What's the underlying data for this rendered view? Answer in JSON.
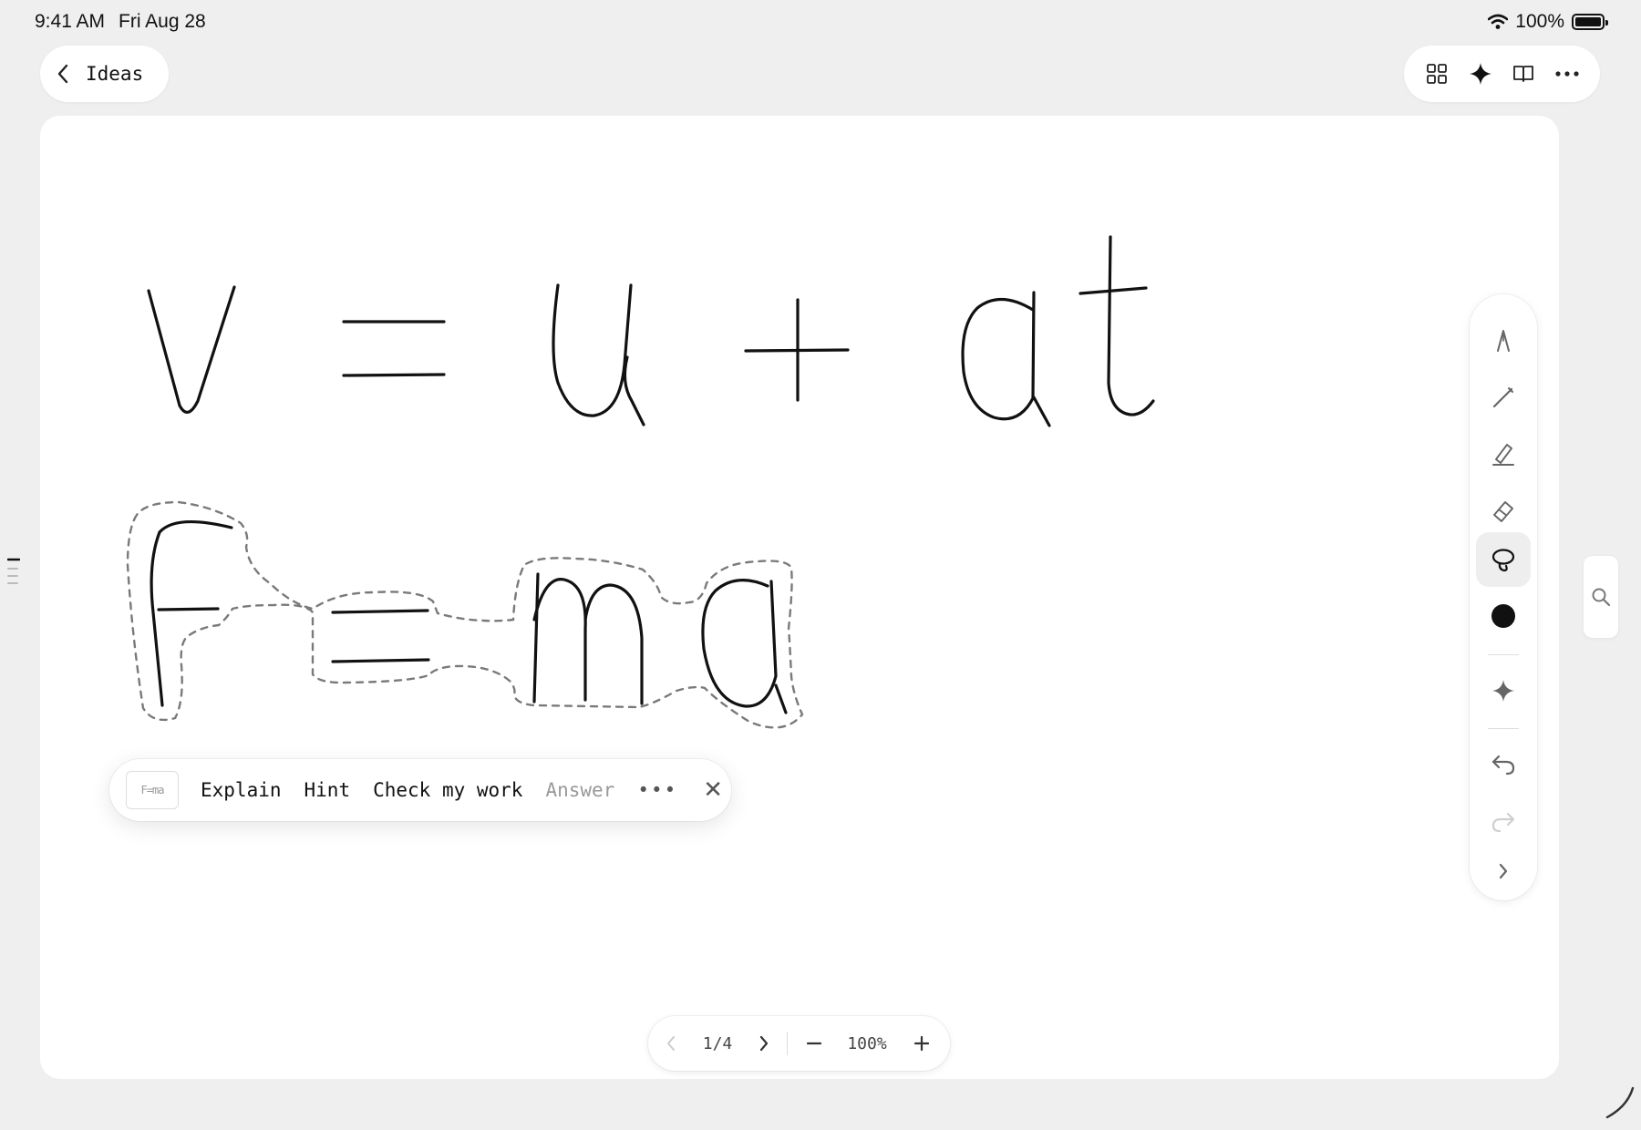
{
  "status_bar": {
    "time": "9:41 AM",
    "date": "Fri Aug 28",
    "battery": "100%"
  },
  "nav": {
    "title": "Ideas"
  },
  "ai_bar": {
    "thumb_text": "F=ma",
    "actions": [
      "Explain",
      "Hint",
      "Check my work",
      "Answer"
    ],
    "more": "•••",
    "close": "✕"
  },
  "pager": {
    "page": "1/4",
    "zoom": "100%"
  },
  "icons": {
    "top_tools": [
      "grid-icon",
      "sparkle-icon",
      "book-icon",
      "more-icon"
    ],
    "rail": [
      "fountain-pen-icon",
      "pencil-icon",
      "highlighter-icon",
      "eraser-icon",
      "lasso-icon",
      "color-swatch",
      "sparkle-icon",
      "undo-icon",
      "redo-icon",
      "chevron-right-icon"
    ]
  },
  "colors": {
    "ink": "#111111",
    "selection_dash": "#7a7a7a",
    "canvas": "#ffffff",
    "background": "#efefef"
  }
}
